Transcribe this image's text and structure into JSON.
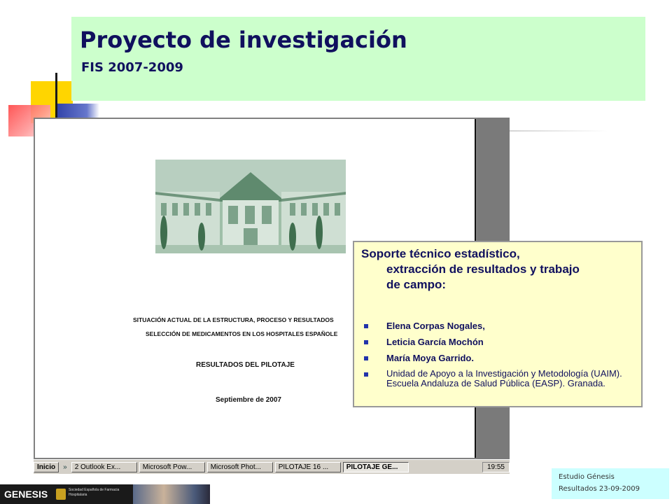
{
  "slide": {
    "title": "Proyecto de investigación",
    "subtitle": "FIS 2007-2009"
  },
  "document": {
    "heading_line1": "SITUACIÓN ACTUAL DE LA ESTRUCTURA, PROCESO Y RESULTADOS",
    "heading_line2": "SELECCIÓN DE MEDICAMENTOS EN LOS HOSPITALES ESPAÑOLE",
    "heading_line3": "RESULTADOS DEL PILOTAJE",
    "date": "Septiembre de 2007"
  },
  "taskbar": {
    "start_label": "Inicio",
    "quick_launch": "»",
    "items": [
      {
        "label": "2 Outlook Ex...",
        "active": false
      },
      {
        "label": "Microsoft Pow...",
        "active": false
      },
      {
        "label": "Microsoft Phot...",
        "active": false
      },
      {
        "label": "PILOTAJE 16 ...",
        "active": false
      },
      {
        "label": "PILOTAJE GE...",
        "active": true
      }
    ],
    "clock": "19:55"
  },
  "overlay": {
    "heading_line1": "Soporte técnico estadístico,",
    "heading_line2": "extracción de resultados y trabajo",
    "heading_line3": "de campo:",
    "items": [
      "Elena Corpas Nogales,",
      "Leticia García Mochón",
      "María Moya Garrido.",
      "Unidad de Apoyo a la Investigación y  Metodología (UAIM). Escuela Andaluza de Salud Pública (EASP). Granada."
    ]
  },
  "footer": {
    "logo": "GENESIS",
    "society": "Sociedad Española de Farmacia Hospitalaria",
    "study_line1": "Estudio  Génesis",
    "study_line2": "Resultados  23-09-2009"
  },
  "colors": {
    "title_bg": "#ccffcc",
    "title_text": "#10105e",
    "overlay_bg": "#ffffcc",
    "study_bg": "#ccffff"
  }
}
